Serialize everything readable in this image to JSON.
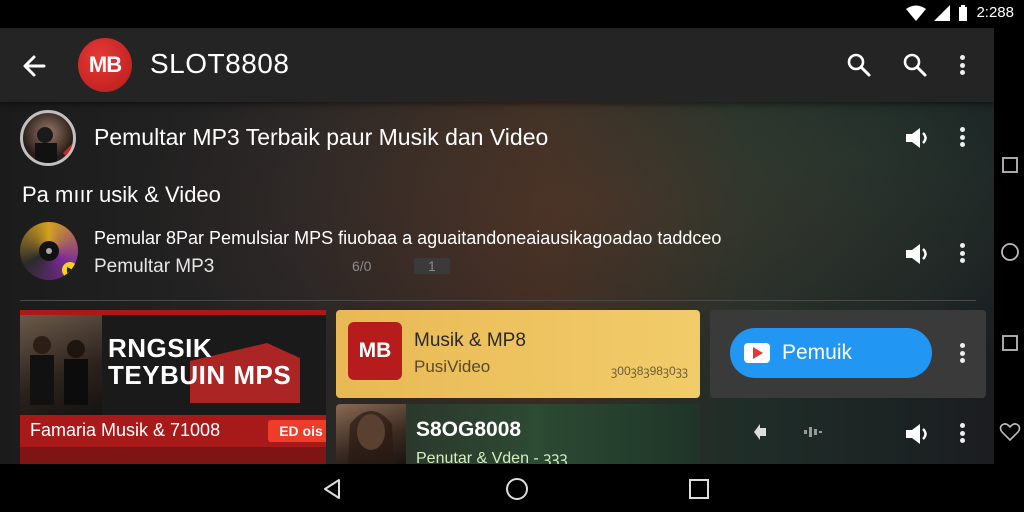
{
  "status": {
    "time": "2:288"
  },
  "toolbar": {
    "logo_text": "MB",
    "title": "SLOT8808"
  },
  "row1": {
    "title": "Pemultar MP3 Terbaik paur Musik dan Video"
  },
  "section": {
    "header": "Pa mıır usik & Video"
  },
  "row2": {
    "title": "Pemular 8Par Pemulsiar MPS fiuobaa a aguaitandoneaiausikagoadao taddceo",
    "subtitle": "Pemultar MP3",
    "meta_a": "6/0",
    "meta_b": "1"
  },
  "cards": {
    "red": {
      "headline_line1": "RNGSIK",
      "headline_line2": "TEYBUIN MPS",
      "bottom_text": "Famaria Musik & 71008",
      "pill": "ED ois"
    },
    "yellow": {
      "logo_text": "MB",
      "title": "Musik & MP8",
      "subtitle": "PusiVideo",
      "meta": "ꝫ00ꝫ8ꝫ98ꝫ0ꝫꝫ"
    },
    "green": {
      "title": "S8OG8008",
      "subtitle": "Penutar & Vden - ꝫꝫꝫ"
    },
    "dark": {
      "button_label": "Pemuik"
    }
  },
  "colors": {
    "accent_blue": "#2196f3",
    "brand_red": "#c62828",
    "card_yellow": "#f2cc6a"
  }
}
